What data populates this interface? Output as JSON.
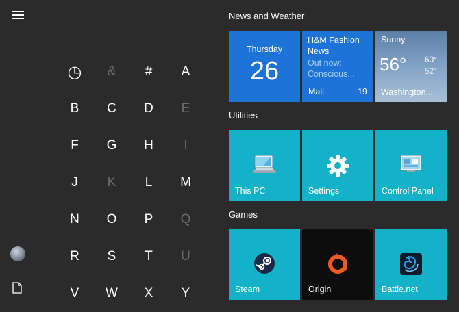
{
  "left_rail": {
    "menu_icon": "hamburger-icon",
    "avatar_icon": "user-avatar",
    "documents_icon": "document-icon"
  },
  "alphabet": [
    {
      "label": "◷",
      "enabled": true
    },
    {
      "label": "&",
      "enabled": false
    },
    {
      "label": "#",
      "enabled": true
    },
    {
      "label": "A",
      "enabled": true
    },
    {
      "label": "B",
      "enabled": true
    },
    {
      "label": "C",
      "enabled": true
    },
    {
      "label": "D",
      "enabled": true
    },
    {
      "label": "E",
      "enabled": false
    },
    {
      "label": "F",
      "enabled": true
    },
    {
      "label": "G",
      "enabled": true
    },
    {
      "label": "H",
      "enabled": true
    },
    {
      "label": "I",
      "enabled": false
    },
    {
      "label": "J",
      "enabled": true
    },
    {
      "label": "K",
      "enabled": false
    },
    {
      "label": "L",
      "enabled": true
    },
    {
      "label": "M",
      "enabled": true
    },
    {
      "label": "N",
      "enabled": true
    },
    {
      "label": "O",
      "enabled": true
    },
    {
      "label": "P",
      "enabled": true
    },
    {
      "label": "Q",
      "enabled": false
    },
    {
      "label": "R",
      "enabled": true
    },
    {
      "label": "S",
      "enabled": true
    },
    {
      "label": "T",
      "enabled": true
    },
    {
      "label": "U",
      "enabled": false
    },
    {
      "label": "V",
      "enabled": true
    },
    {
      "label": "W",
      "enabled": true
    },
    {
      "label": "X",
      "enabled": true
    },
    {
      "label": "Y",
      "enabled": true
    }
  ],
  "groups": {
    "news": "News and Weather",
    "utilities": "Utilities",
    "games": "Games"
  },
  "tiles": {
    "calendar": {
      "day": "Thursday",
      "date": "26",
      "color": "#1e73d6"
    },
    "mail": {
      "title": "H&M Fashion News",
      "subtitle": "Out now: Conscious...",
      "label": "Mail",
      "count": "19",
      "color": "#1e73d6"
    },
    "weather": {
      "condition": "Sunny",
      "temp": "56°",
      "high": "60°",
      "low": "52°",
      "location": "Washington,..."
    },
    "this_pc": {
      "label": "This PC",
      "icon": "computer-icon",
      "color": "#13b2c8"
    },
    "settings": {
      "label": "Settings",
      "icon": "gear-icon",
      "color": "#13b2c8"
    },
    "control_panel": {
      "label": "Control Panel",
      "icon": "control-panel-icon",
      "color": "#13b2c8"
    },
    "steam": {
      "label": "Steam",
      "icon": "steam-icon",
      "color": "#13b2c8"
    },
    "origin": {
      "label": "Origin",
      "icon": "origin-icon",
      "color": "#0d0d0d"
    },
    "battlenet": {
      "label": "Battle.net",
      "icon": "battlenet-icon",
      "color": "#13b2c8"
    }
  }
}
